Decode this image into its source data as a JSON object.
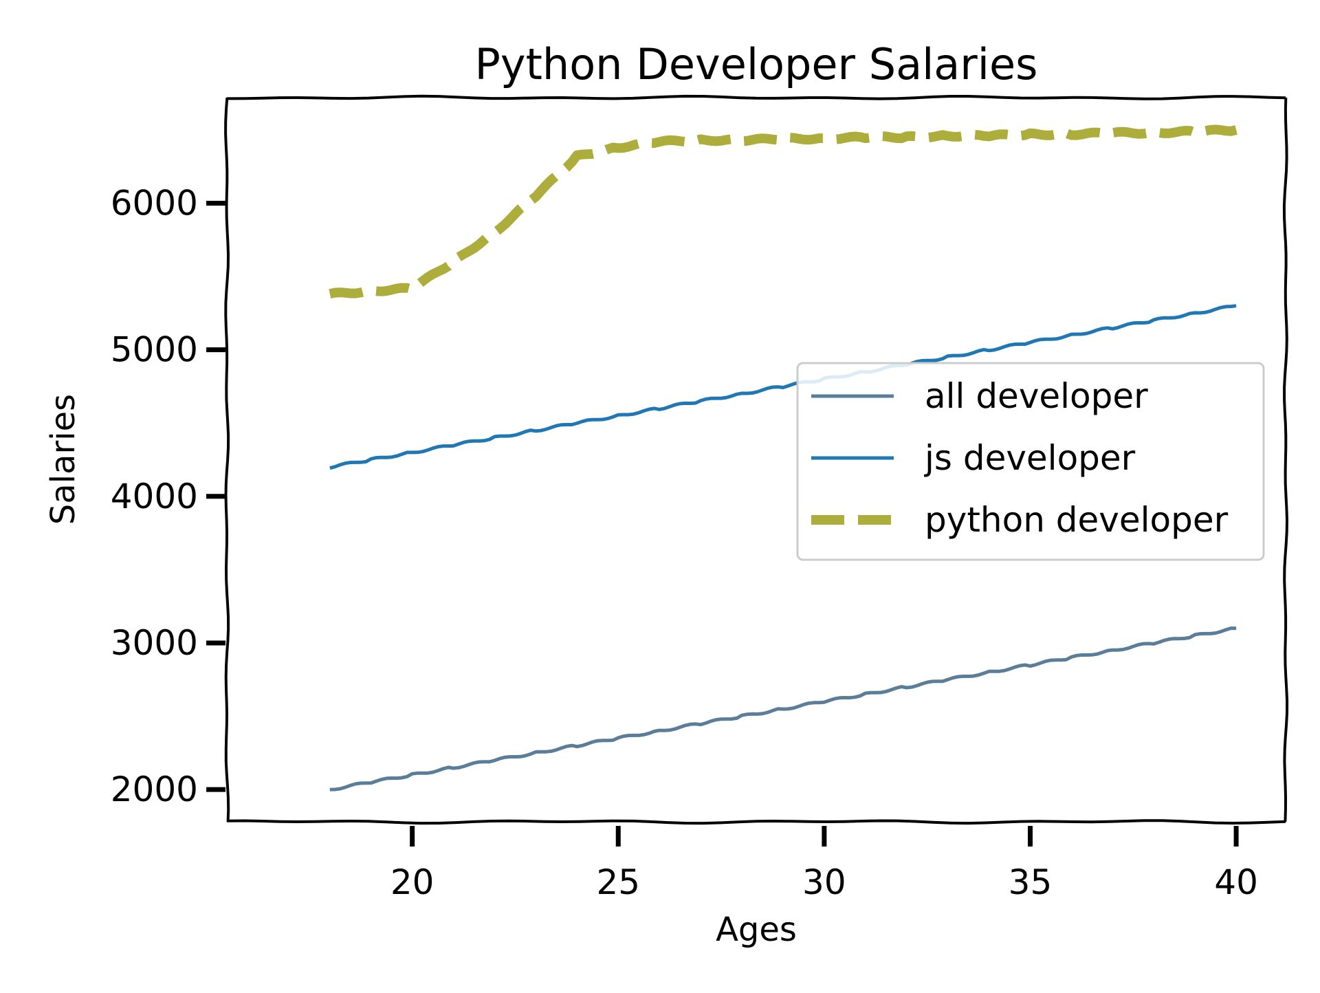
{
  "chart_data": {
    "type": "line",
    "title": "Python Developer Salaries",
    "xlabel": "Ages",
    "ylabel": "Salaries",
    "x": [
      18,
      19,
      20,
      21,
      22,
      23,
      24,
      25,
      26,
      27,
      28,
      29,
      30,
      31,
      32,
      33,
      34,
      35,
      36,
      37,
      38,
      39,
      40
    ],
    "xlim": [
      15.5,
      41.2
    ],
    "ylim": [
      1780,
      6720
    ],
    "xticks": [
      20,
      25,
      30,
      35,
      40
    ],
    "yticks": [
      2000,
      3000,
      4000,
      5000,
      6000
    ],
    "grid": false,
    "legend_position": "center-right",
    "series": [
      {
        "name": "all developer",
        "color": "#5a7d9a",
        "style": "solid",
        "values": [
          2000,
          2050,
          2100,
          2150,
          2200,
          2250,
          2300,
          2350,
          2400,
          2450,
          2500,
          2550,
          2600,
          2650,
          2700,
          2750,
          2800,
          2850,
          2900,
          2950,
          3000,
          3050,
          3100
        ]
      },
      {
        "name": "js developer",
        "color": "#1f77b4",
        "style": "solid",
        "values": [
          4200,
          4250,
          4300,
          4350,
          4400,
          4450,
          4500,
          4550,
          4600,
          4650,
          4700,
          4750,
          4800,
          4850,
          4900,
          4950,
          5000,
          5050,
          5100,
          5150,
          5200,
          5250,
          5300
        ]
      },
      {
        "name": "python developer",
        "color": "#adad3b",
        "style": "dashed",
        "values": [
          5380,
          5400,
          5420,
          5600,
          5800,
          6050,
          6320,
          6380,
          6420,
          6430,
          6430,
          6440,
          6440,
          6450,
          6450,
          6460,
          6460,
          6470,
          6470,
          6480,
          6480,
          6490,
          6500
        ]
      }
    ]
  }
}
